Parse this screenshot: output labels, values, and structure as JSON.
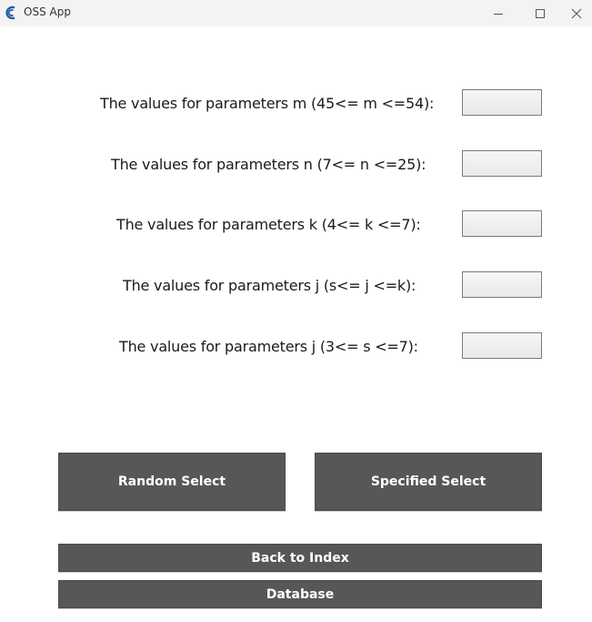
{
  "window": {
    "title": "OSS App",
    "icon": "oss-app-logo-icon",
    "controls": [
      "minimize-icon",
      "maximize-icon",
      "close-icon"
    ]
  },
  "params": [
    {
      "label": "The values for parameters m (45<= m <=54):",
      "value": ""
    },
    {
      "label": "The values for parameters n (7<= n <=25):",
      "value": ""
    },
    {
      "label": "The values for parameters k (4<= k <=7):",
      "value": ""
    },
    {
      "label": "The values for parameters j (s<= j <=k):",
      "value": ""
    },
    {
      "label": "The values for parameters j (3<= s <=7):",
      "value": ""
    }
  ],
  "buttons": {
    "random_select": "Random Select",
    "specified_select": "Specified Select",
    "back_to_index": "Back to Index",
    "database": "Database"
  },
  "colors": {
    "button_bg": "#575757",
    "button_text": "#ffffff",
    "titlebar_bg": "#f3f3f3",
    "app_icon": "#1f5fa8"
  }
}
